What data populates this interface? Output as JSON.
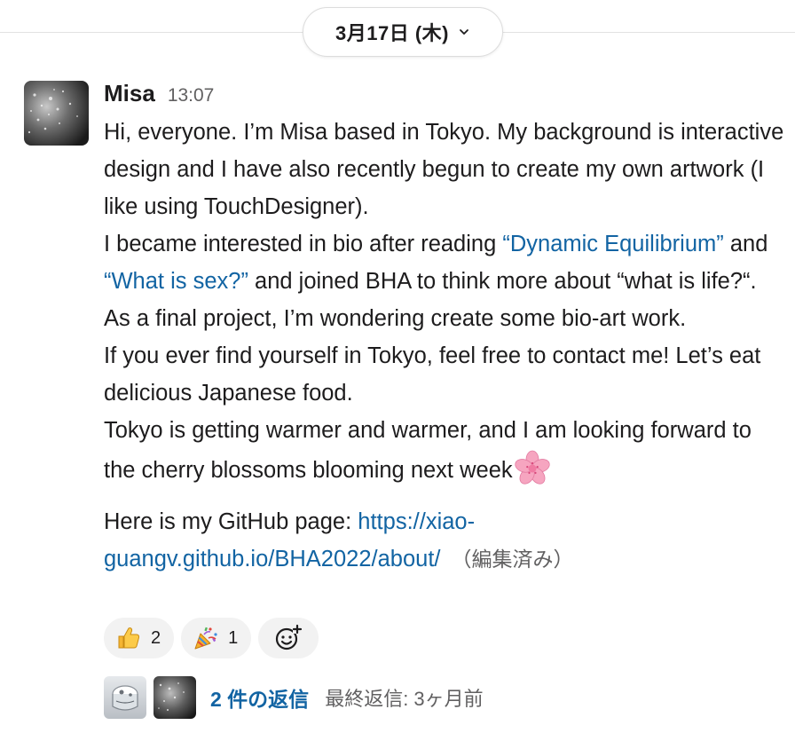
{
  "date_divider": {
    "label": "3月17日 (木)",
    "chevron_icon": "chevron-down-icon"
  },
  "message": {
    "sender": "Misa",
    "timestamp": "13:07",
    "avatar_icon": "user-avatar",
    "paragraph_1": {
      "line_1": "Hi, everyone. I’m Misa based in Tokyo. My background is interactive design and I have also recently begun to create my own artwork (I like using TouchDesigner).",
      "line_2_pre": "I became interested in bio after reading ",
      "link_1": "“Dynamic Equilibrium”",
      "line_2_mid": "and ",
      "link_2": "“What is sex?”",
      "line_2_post": " and joined BHA to think more about “what is life?“.",
      "line_3": "As a final project, I’m wondering create some bio-art work.",
      "line_4": "If you ever find yourself in Tokyo, feel free to contact me! Let’s eat delicious Japanese food.",
      "line_5": "Tokyo is getting warmer and warmer, and I am looking forward to the cherry blossoms blooming next week",
      "line_5_emoji": "cherry-blossom-emoji"
    },
    "paragraph_2": {
      "pre": "Here is my GitHub page: ",
      "link": "https://xiao-guangv.github.io/BHA2022/about/",
      "edited_label": "（編集済み）"
    }
  },
  "reactions": [
    {
      "emoji": "thumbs-up-emoji",
      "count": "2"
    },
    {
      "emoji": "party-popper-emoji",
      "count": "1"
    }
  ],
  "add_reaction_icon": "add-reaction-icon",
  "thread": {
    "reply_count_label": "2 件の返信",
    "last_reply_label": "最終返信: 3ヶ月前"
  },
  "colors": {
    "link": "#1264a3",
    "muted": "#616061",
    "text": "#1d1c1d",
    "reaction_bg": "#f2f2f2"
  }
}
